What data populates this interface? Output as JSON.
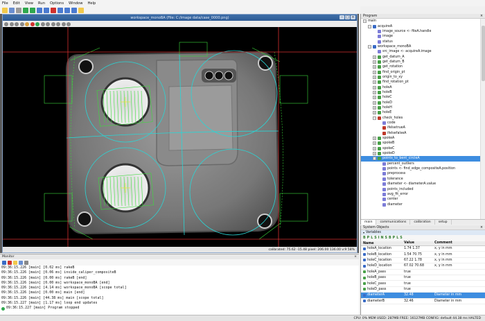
{
  "menu": [
    "File",
    "Edit",
    "View",
    "Run",
    "Options",
    "Window",
    "Help"
  ],
  "image_window": {
    "title": "workspace_monoBA (File: C:/image data/case_0000.png)",
    "status": "calibrated: 75.62 -15.48 pixel: 206.00 136.00 v:9 58%"
  },
  "program": {
    "title": "Program",
    "tree": [
      {
        "label": "main",
        "level": 0,
        "exp": "minus",
        "icon": "none"
      },
      {
        "label": "acquireA",
        "level": 1,
        "exp": "minus",
        "icon": "#3a6bc5"
      },
      {
        "label": "image_source <- fileA.handle",
        "level": 2,
        "exp": "none",
        "icon": "#7d7dd8"
      },
      {
        "label": "image",
        "level": 2,
        "exp": "none",
        "icon": "#7d7dd8"
      },
      {
        "label": "status",
        "level": 2,
        "exp": "none",
        "icon": "#7d7dd8"
      },
      {
        "label": "workspace_monoBA",
        "level": 1,
        "exp": "minus",
        "icon": "#3a6bc5"
      },
      {
        "label": "src_image <- acquireA.image",
        "level": 2,
        "exp": "none",
        "icon": "#7d7dd8"
      },
      {
        "label": "get_datum_A",
        "level": 2,
        "exp": "plus",
        "icon": "#49a049"
      },
      {
        "label": "get_datum_B",
        "level": 2,
        "exp": "plus",
        "icon": "#49a049"
      },
      {
        "label": "get_rotation",
        "level": 2,
        "exp": "plus",
        "icon": "#49a049"
      },
      {
        "label": "find_origin_pt",
        "level": 2,
        "exp": "plus",
        "icon": "#49a049"
      },
      {
        "label": "origin_to_xy",
        "level": 2,
        "exp": "plus",
        "icon": "#49a049"
      },
      {
        "label": "find_rotation_pt",
        "level": 2,
        "exp": "plus",
        "icon": "#49a049"
      },
      {
        "label": "holeA",
        "level": 2,
        "exp": "plus",
        "icon": "#49a049"
      },
      {
        "label": "holeB",
        "level": 2,
        "exp": "plus",
        "icon": "#49a049"
      },
      {
        "label": "holeC",
        "level": 2,
        "exp": "plus",
        "icon": "#49a049"
      },
      {
        "label": "holeD",
        "level": 2,
        "exp": "plus",
        "icon": "#49a049"
      },
      {
        "label": "holeH",
        "level": 2,
        "exp": "plus",
        "icon": "#49a049"
      },
      {
        "label": "holeE",
        "level": 2,
        "exp": "plus",
        "icon": "#49a049"
      },
      {
        "label": "check_holes",
        "level": 2,
        "exp": "minus",
        "icon": "#c0392b"
      },
      {
        "label": "code",
        "level": 3,
        "exp": "none",
        "icon": "#7d7dd8"
      },
      {
        "label": "ifelsetrueA",
        "level": 3,
        "exp": "none",
        "icon": "#c0392b"
      },
      {
        "label": "ifelsefalseA",
        "level": 3,
        "exp": "none",
        "icon": "#c0392b"
      },
      {
        "label": "spokeA",
        "level": 2,
        "exp": "plus",
        "icon": "#49a049"
      },
      {
        "label": "spokeB",
        "level": 2,
        "exp": "plus",
        "icon": "#49a049"
      },
      {
        "label": "spokeC",
        "level": 2,
        "exp": "plus",
        "icon": "#49a049"
      },
      {
        "label": "spokeD",
        "level": 2,
        "exp": "plus",
        "icon": "#49a049"
      },
      {
        "label": "points_to_bent_circleA",
        "level": 2,
        "exp": "minus",
        "icon": "#49a049",
        "selected": true
      },
      {
        "label": "percent_outliers",
        "level": 3,
        "exp": "none",
        "icon": "#7d7dd8"
      },
      {
        "label": "points <- find_edge_compositeA.position",
        "level": 3,
        "exp": "none",
        "icon": "#7d7dd8"
      },
      {
        "label": "preprocess",
        "level": 3,
        "exp": "none",
        "icon": "#7d7dd8"
      },
      {
        "label": "tolerance",
        "level": 3,
        "exp": "none",
        "icon": "#7d7dd8"
      },
      {
        "label": "diameter <- diameterA.value",
        "level": 3,
        "exp": "none",
        "icon": "#7d7dd8"
      },
      {
        "label": "points_included",
        "level": 3,
        "exp": "none",
        "icon": "#7d7dd8"
      },
      {
        "label": "avg_fit_error",
        "level": 3,
        "exp": "none",
        "icon": "#7d7dd8"
      },
      {
        "label": "center",
        "level": 3,
        "exp": "none",
        "icon": "#7d7dd8"
      },
      {
        "label": "diameter",
        "level": 3,
        "exp": "none",
        "icon": "#7d7dd8"
      }
    ],
    "tabs": [
      "main",
      "communications",
      "calibration",
      "setup"
    ]
  },
  "system_objects": {
    "title": "System Objects",
    "variables_label": "Variables",
    "toolbar": [
      "B",
      "P",
      "L",
      "S",
      "I",
      "N",
      "S",
      "B",
      "P",
      "L",
      "S"
    ],
    "columns": [
      "Name",
      "Value",
      "Comment"
    ],
    "rows": [
      {
        "name": "holeA_location",
        "value": "1.74 1.37",
        "comment": "x, y in mm",
        "color": "#3a6bc5"
      },
      {
        "name": "holeB_location",
        "value": "1.54 70.75",
        "comment": "x, y in mm",
        "color": "#3a6bc5"
      },
      {
        "name": "holeC_location",
        "value": "67.22 1.78",
        "comment": "x, y in mm",
        "color": "#3a6bc5"
      },
      {
        "name": "holeD_location",
        "value": "67.02 70.68",
        "comment": "x, y in mm",
        "color": "#3a6bc5"
      },
      {
        "name": "holeA_pass",
        "value": "true",
        "comment": "",
        "color": "#49a049"
      },
      {
        "name": "holeB_pass",
        "value": "true",
        "comment": "",
        "color": "#49a049"
      },
      {
        "name": "holeC_pass",
        "value": "true",
        "comment": "",
        "color": "#49a049"
      },
      {
        "name": "holeD_pass",
        "value": "true",
        "comment": "",
        "color": "#49a049"
      },
      {
        "name": "diameterA",
        "value": "32.48",
        "comment": "Diameter in mm",
        "color": "#3a6bc5",
        "selected": true
      },
      {
        "name": "diameterB",
        "value": "32.46",
        "comment": "Diameter in mm",
        "color": "#3a6bc5"
      }
    ]
  },
  "monitor": {
    "title": "Monitor",
    "log": [
      "09:36:15.226 [main] [0.02 ms] rakeB",
      "09:36:15.226 [main] [0.06 ms] inside_caliper_compositeB",
      "09:36:15.226 [main] [0.00 ms] rakeB [end]",
      "09:36:15.226 [main] [0.00 ms] workspace_monoBA [end]",
      "09:36:15.226 [main] [4.14 ms] workspace_monoBA [scope total]",
      "09:36:15.226 [main] [0.00 ms] main [end]",
      "09:36:15.226 [main] [44.38 ms] main [scope total]",
      "09:36:15.227 [main] [1.17 ms] loop end updates",
      "09:36:15.227 [main] Program stopped"
    ]
  },
  "statusbar": "CPU: 0%  MEM USED: 287MB  FREE: 16127MB  CONFIG: default  44.38 ms  HALTED"
}
